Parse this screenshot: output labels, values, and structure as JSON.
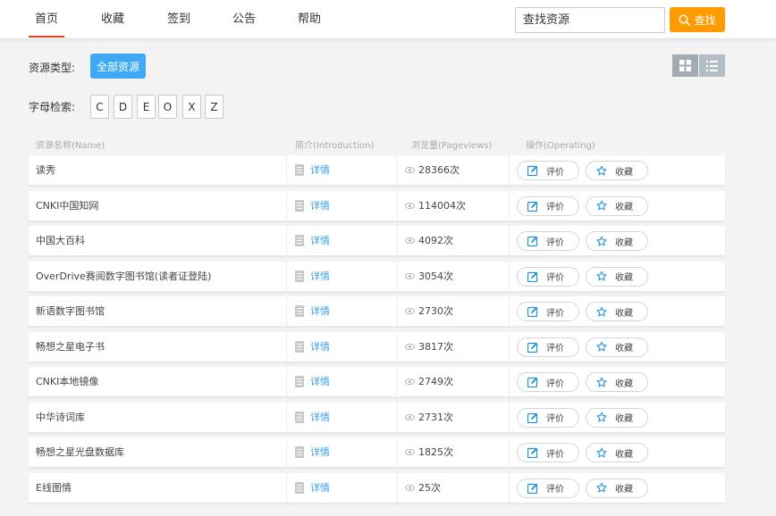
{
  "nav": {
    "items": [
      {
        "label": "首页",
        "active": true
      },
      {
        "label": "收藏",
        "active": false
      },
      {
        "label": "签到",
        "active": false
      },
      {
        "label": "公告",
        "active": false
      },
      {
        "label": "帮助",
        "active": false
      }
    ]
  },
  "search": {
    "placeholder": "查找资源",
    "button_label": "查找"
  },
  "filters": {
    "type_label": "资源类型:",
    "all_label": "全部资源",
    "letter_label": "字母检索:",
    "letters": [
      "C",
      "D",
      "E",
      "O",
      "X",
      "Z"
    ]
  },
  "table": {
    "headers": {
      "name": "资源名称(Name)",
      "intro": "简介(Introduction)",
      "views": "浏览量(Pageviews)",
      "ops": "操作(Operating)"
    },
    "detail_label": "详情",
    "rate_label": "评价",
    "fav_label": "收藏",
    "rows": [
      {
        "name": "读秀",
        "views": "28366次"
      },
      {
        "name": "CNKI中国知网",
        "views": "114004次"
      },
      {
        "name": "中国大百科",
        "views": "4092次"
      },
      {
        "name": "OverDrive赛阅数字图书馆(读者证登陆)",
        "views": "3054次"
      },
      {
        "name": "新语数字图书馆",
        "views": "2730次"
      },
      {
        "name": "畅想之星电子书",
        "views": "3817次"
      },
      {
        "name": "CNKI本地镜像",
        "views": "2749次"
      },
      {
        "name": "中华诗词库",
        "views": "2731次"
      },
      {
        "name": "畅想之星光盘数据库",
        "views": "1825次"
      },
      {
        "name": "E线图情",
        "views": "25次"
      }
    ]
  },
  "colors": {
    "accent_orange": "#fe9b00",
    "accent_blue": "#3fa9f5",
    "active_underline": "#e8401c",
    "link_blue": "#3aa0e8"
  }
}
